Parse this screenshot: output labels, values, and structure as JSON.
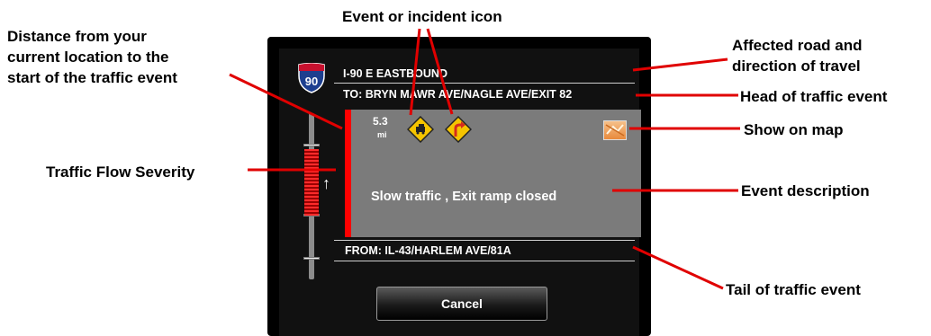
{
  "annotations": {
    "event_icon": "Event or incident icon",
    "distance": [
      "Distance from your",
      "current location to the",
      "start of the traffic event"
    ],
    "affected_road": [
      "Affected road and",
      "direction of travel"
    ],
    "head": "Head of traffic event",
    "show_on_map": "Show on map",
    "severity": "Traffic Flow Severity",
    "description": "Event description",
    "tail": "Tail of traffic event"
  },
  "shield": {
    "number": "90",
    "colors": {
      "top": "#c8102e",
      "body": "#1d3f8f"
    }
  },
  "road": "I-90 E EASTBOUND",
  "head_text": "TO: BRYN MAWR AVE/NAGLE AVE/EXIT 82",
  "tail_text": "FROM: IL-43/HARLEM AVE/81A",
  "event": {
    "distance_value": "5.3",
    "distance_unit": "mi",
    "icons": [
      "slow-traffic-icon",
      "exit-ramp-closed-icon"
    ],
    "description": "Slow traffic , Exit ramp closed"
  },
  "severity_color": "#ff0000",
  "cancel_label": "Cancel"
}
